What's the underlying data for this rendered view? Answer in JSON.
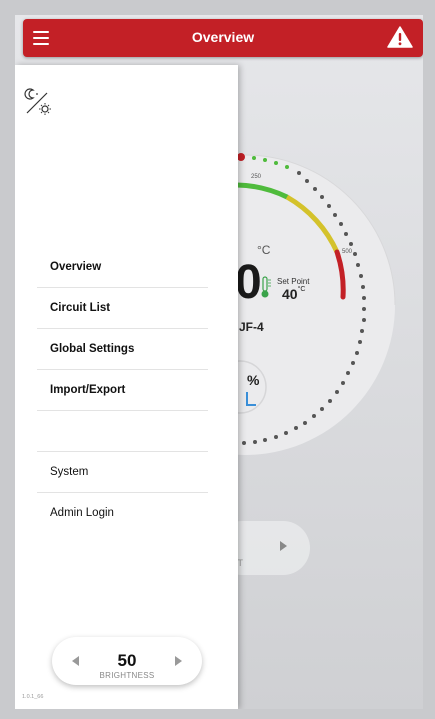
{
  "header": {
    "title": "Overview",
    "menu_icon": "hamburger-icon",
    "alert_icon": "warning-triangle-icon",
    "color": "#c32026"
  },
  "background": {
    "gauge_labels": [
      "250",
      "500"
    ],
    "temperature": "0",
    "temperature_unit": "°C",
    "set_point_label": "Set Point",
    "set_point_value": "40",
    "set_point_unit": "°C",
    "circuit_name": "JF-4",
    "output_percent_symbol": "%",
    "bottom_button_text": "IT"
  },
  "drawer": {
    "theme_toggle_icon": "moon-sun-icon",
    "menu_items": [
      {
        "label": "Overview"
      },
      {
        "label": "Circuit List"
      },
      {
        "label": "Global Settings"
      },
      {
        "label": "Import/Export"
      },
      {
        "label": "System"
      },
      {
        "label": "Admin Login"
      }
    ],
    "brightness": {
      "value": "50",
      "label": "BRIGHTNESS"
    },
    "version": "1.0.1_66"
  }
}
